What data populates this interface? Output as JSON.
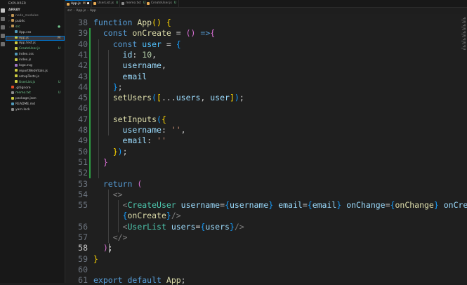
{
  "sidebar": {
    "header": "EXPLORER",
    "root": "ARRAY",
    "items": [
      {
        "label": "node_modules",
        "type": "folder",
        "status": "ignored",
        "badge": ""
      },
      {
        "label": "public",
        "type": "folder",
        "status": "normal",
        "badge": ""
      },
      {
        "label": "src",
        "type": "folder",
        "status": "untracked",
        "badge": "●"
      },
      {
        "label": "App.css",
        "type": "css",
        "status": "normal",
        "badge": ""
      },
      {
        "label": "App.js",
        "type": "js",
        "status": "modified",
        "badge": "M",
        "selected": true
      },
      {
        "label": "App.test.js",
        "type": "js",
        "status": "normal",
        "badge": ""
      },
      {
        "label": "CreateUser.js",
        "type": "js",
        "status": "untracked",
        "badge": "U"
      },
      {
        "label": "index.css",
        "type": "css",
        "status": "normal",
        "badge": ""
      },
      {
        "label": "index.js",
        "type": "js",
        "status": "normal",
        "badge": ""
      },
      {
        "label": "logo.svg",
        "type": "svg",
        "status": "normal",
        "badge": ""
      },
      {
        "label": "reportWebVitals.js",
        "type": "js",
        "status": "normal",
        "badge": ""
      },
      {
        "label": "setupTests.js",
        "type": "js",
        "status": "normal",
        "badge": ""
      },
      {
        "label": "UserList.js",
        "type": "js",
        "status": "untracked",
        "badge": "U"
      },
      {
        "label": ".gitignore",
        "type": "git",
        "status": "normal",
        "badge": ""
      },
      {
        "label": "memo.txt",
        "type": "txt",
        "status": "untracked",
        "badge": "U"
      },
      {
        "label": "package.json",
        "type": "json",
        "status": "normal",
        "badge": ""
      },
      {
        "label": "README.md",
        "type": "md",
        "status": "normal",
        "badge": ""
      },
      {
        "label": "yarn.lock",
        "type": "lock",
        "status": "normal",
        "badge": ""
      }
    ]
  },
  "tabs": [
    {
      "label": "App.js",
      "state": "M",
      "dirty": true,
      "active": true
    },
    {
      "label": "UserList.js",
      "state": "U",
      "dirty": false,
      "active": false
    },
    {
      "label": "memo.txt",
      "state": "U",
      "dirty": false,
      "active": false
    },
    {
      "label": "CreateUser.js",
      "state": "U",
      "dirty": false,
      "active": false
    }
  ],
  "breadcrumb": [
    "src",
    "App.js",
    "App"
  ],
  "editor": {
    "current_line": "58",
    "lines": [
      {
        "n": "38",
        "html": "<span class='k'>function</span> <span class='f'>App</span><span class='b1'>()</span> <span class='b1'>{</span>"
      },
      {
        "n": "39",
        "html": "  <span class='k'>const</span> <span class='f'>onCreate</span> <span class='o'>=</span> <span class='b2'>()</span> <span class='k'>=&gt;</span><span class='b2'>{</span>"
      },
      {
        "n": "40",
        "html": "    <span class='k'>const</span> <span class='c'>user</span> <span class='o'>=</span> <span class='b3'>{</span>"
      },
      {
        "n": "41",
        "html": "      <span class='v'>id</span>: <span class='n'>10</span>,"
      },
      {
        "n": "42",
        "html": "      <span class='v'>username</span>,"
      },
      {
        "n": "43",
        "html": "      <span class='v'>email</span>"
      },
      {
        "n": "44",
        "html": "    <span class='b3'>}</span>;"
      },
      {
        "n": "45",
        "html": "    <span class='f'>setUsers</span><span class='b3'>(</span><span class='b1'>[</span>...<span class='v'>users</span>, <span class='v'>user</span><span class='b1'>]</span><span class='b3'>)</span>;"
      },
      {
        "n": "46",
        "html": ""
      },
      {
        "n": "47",
        "html": "    <span class='f'>setInputs</span><span class='b3'>(</span><span class='b1'>{</span>"
      },
      {
        "n": "48",
        "html": "      <span class='v'>username</span>: <span class='s'>''</span>,"
      },
      {
        "n": "49",
        "html": "      <span class='v'>email</span>: <span class='s'>''</span>"
      },
      {
        "n": "50",
        "html": "    <span class='b1'>}</span><span class='b3'>)</span>;"
      },
      {
        "n": "51",
        "html": "  <span class='b2'>}</span>"
      },
      {
        "n": "52",
        "html": ""
      },
      {
        "n": "53",
        "html": "  <span class='k'>return</span> <span class='b2'>(</span>"
      },
      {
        "n": "54",
        "html": "    <span class='p'>&lt;&gt;</span>"
      },
      {
        "n": "55",
        "html": "      <span class='p'>&lt;</span><span class='t'>CreateUser</span> <span class='v'>username</span>=<span class='b3'>{</span><span class='v'>username</span><span class='b3'>}</span> <span class='v'>email</span>=<span class='b3'>{</span><span class='v'>email</span><span class='b3'>}</span> <span class='v'>onChange</span>=<span class='b3'>{</span><span class='f'>onChange</span><span class='b3'>}</span> <span class='v'>onCreate</span>="
      },
      {
        "n": "",
        "html": "      <span class='b3'>{</span><span class='f'>onCreate</span><span class='b3'>}</span><span class='p'>/&gt;</span>"
      },
      {
        "n": "56",
        "html": "      <span class='p'>&lt;</span><span class='t'>UserList</span> <span class='v'>users</span>=<span class='b3'>{</span><span class='v'>users</span><span class='b3'>}</span><span class='p'>/&gt;</span>"
      },
      {
        "n": "57",
        "html": "    <span class='p'>&lt;/&gt;</span>"
      },
      {
        "n": "58",
        "html": "  <span class='b2'>)</span>;"
      },
      {
        "n": "59",
        "html": "<span class='b1'>}</span>"
      },
      {
        "n": "60",
        "html": ""
      },
      {
        "n": "61",
        "html": "<span class='k'>export</span> <span class='k'>default</span> <span class='f'>App</span>;"
      }
    ]
  },
  "colors": {
    "accent": "#0078d4",
    "untracked": "#73c991",
    "modified": "#e2c08d",
    "scm_added": "#2ea043"
  }
}
